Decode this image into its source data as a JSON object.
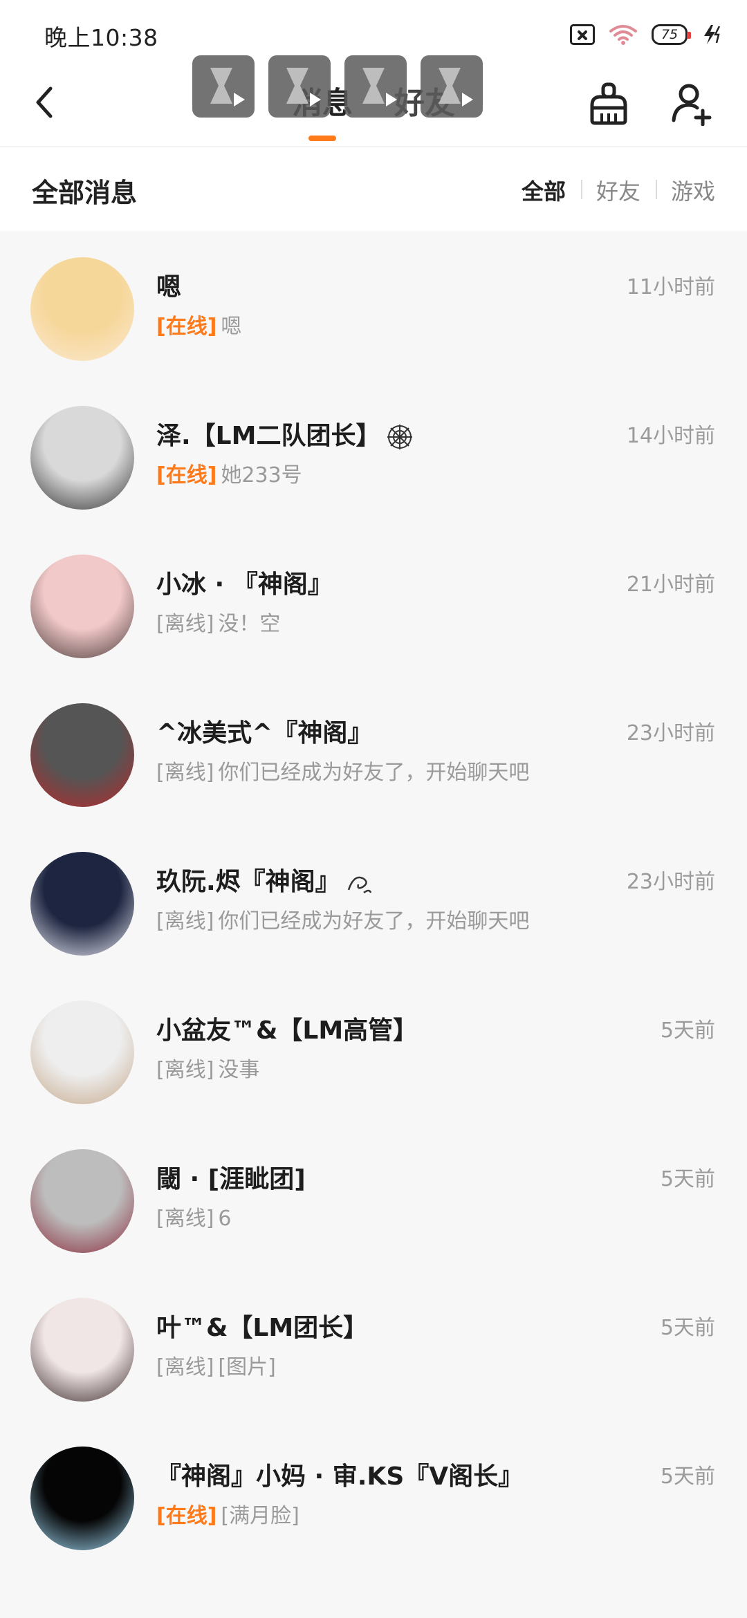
{
  "status_bar": {
    "time": "晚上10:38",
    "battery": "75",
    "icons": [
      "no-sim-icon",
      "wifi-icon",
      "battery-icon",
      "charging-icon"
    ]
  },
  "header": {
    "tabs": [
      {
        "label": "消息",
        "active": true
      },
      {
        "label": "好友",
        "active": false
      }
    ],
    "actions": [
      "clean-icon",
      "add-friend-icon"
    ]
  },
  "filter": {
    "title": "全部消息",
    "tabs": [
      "全部",
      "好友",
      "游戏"
    ],
    "selected": "全部"
  },
  "colors": {
    "accent": "#ff7a1a",
    "online": "#ff7a1a",
    "muted": "#9a9a9a"
  },
  "messages": [
    {
      "name": "嗯",
      "status": "[在线]",
      "online": true,
      "preview": "嗯",
      "time": "11小时前",
      "avatar_colors": [
        "#f6d79a",
        "#fbe8d0"
      ]
    },
    {
      "name": "泽.【LM二队团长】",
      "status": "[在线]",
      "online": true,
      "preview": "她233号",
      "time": "14小时前",
      "avatar_colors": [
        "#d9d9d9",
        "#333333"
      ],
      "icon": "spiderweb-icon"
    },
    {
      "name": "小冰 · 『神阁』",
      "status": "[离线]",
      "online": false,
      "preview": "没！空",
      "time": "21小时前",
      "avatar_colors": [
        "#f2c9c9",
        "#4a3a3a"
      ]
    },
    {
      "name": "^冰美式^『神阁』",
      "status": "[离线]",
      "online": false,
      "preview": "你们已经成为好友了，开始聊天吧",
      "time": "23小时前",
      "avatar_colors": [
        "#555555",
        "#b8282a"
      ]
    },
    {
      "name": "玖阮.烬『神阁』",
      "status": "[离线]",
      "online": false,
      "preview": "你们已经成为好友了，开始聊天吧",
      "time": "23小时前",
      "avatar_colors": [
        "#1d2540",
        "#e8e8f2"
      ],
      "icon": "swirl-icon"
    },
    {
      "name": "小盆友™&【LM高管】",
      "status": "[离线]",
      "online": false,
      "preview": "没事",
      "time": "5天前",
      "avatar_colors": [
        "#eeeeee",
        "#c5a88a"
      ]
    },
    {
      "name": "閾 · [涯眦团]",
      "status": "[离线]",
      "online": false,
      "preview": "6",
      "time": "5天前",
      "avatar_colors": [
        "#bdbdbd",
        "#8a2a3a"
      ]
    },
    {
      "name": "叶™&【LM团长】",
      "status": "[离线]",
      "online": false,
      "preview": "[图片]",
      "time": "5天前",
      "avatar_colors": [
        "#f1e6e6",
        "#3a2a2a"
      ]
    },
    {
      "name": "『神阁』小妈 · 审.KS『V阁长』",
      "status": "[在线]",
      "online": true,
      "preview": "[满月脸]",
      "time": "5天前",
      "avatar_colors": [
        "#050505",
        "#9fd6f2"
      ]
    }
  ]
}
